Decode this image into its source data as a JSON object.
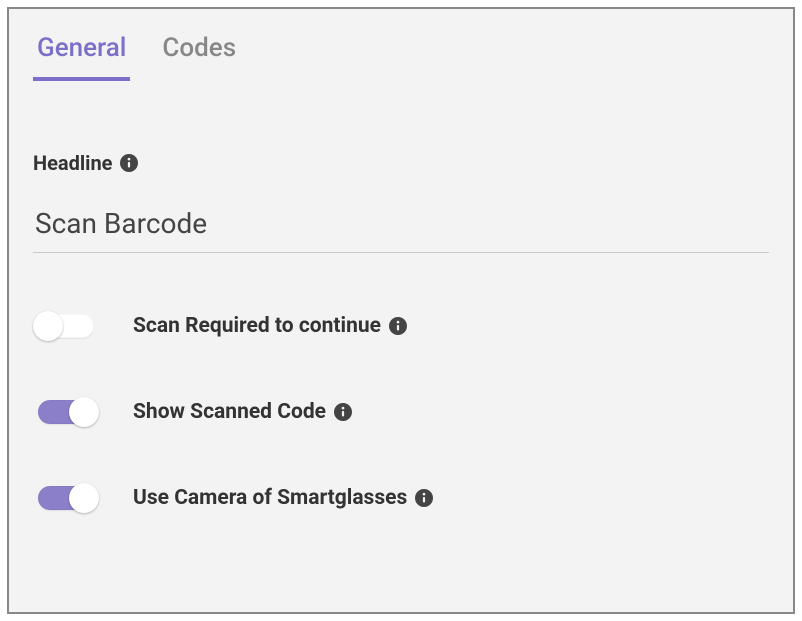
{
  "tabs": {
    "general": "General",
    "codes": "Codes"
  },
  "headlineLabel": "Headline",
  "headlineValue": "Scan Barcode",
  "options": {
    "scanRequired": {
      "label": "Scan Required to continue",
      "on": false
    },
    "showScanned": {
      "label": "Show Scanned Code",
      "on": true
    },
    "useCamera": {
      "label": "Use Camera of Smartglasses",
      "on": true
    }
  }
}
